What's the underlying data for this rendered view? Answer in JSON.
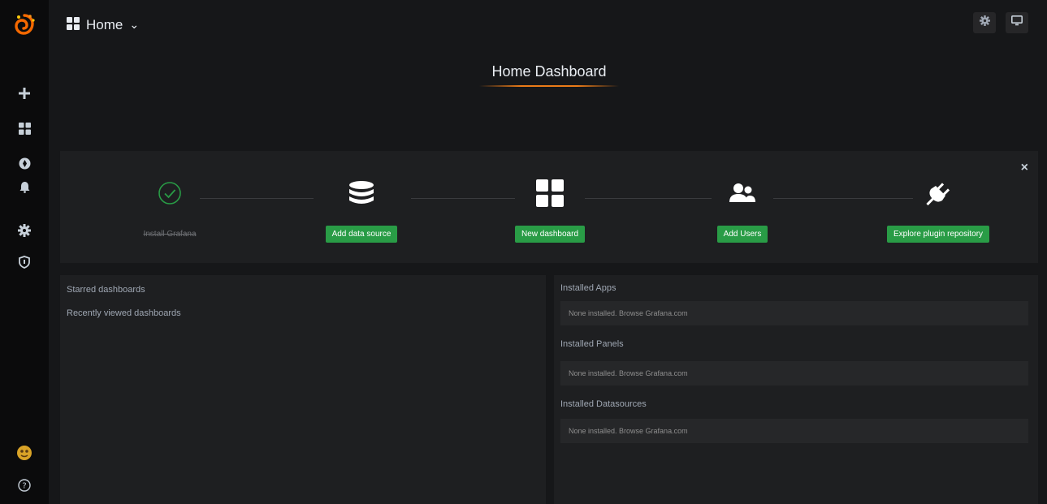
{
  "app": {
    "brand_color": "#eb7b18",
    "accent_color": "#299c46"
  },
  "sidebar": {
    "logo_icon": "grafana-logo-icon",
    "items": [
      {
        "name": "create",
        "icon": "plus-icon"
      },
      {
        "name": "dashboards",
        "icon": "grid-icon"
      },
      {
        "name": "explore",
        "icon": "compass-icon"
      },
      {
        "name": "alerting",
        "icon": "bell-icon"
      },
      {
        "name": "configuration",
        "icon": "gear-icon"
      },
      {
        "name": "server-admin",
        "icon": "shield-icon"
      }
    ],
    "bottom": [
      {
        "name": "profile",
        "icon": "avatar-icon"
      },
      {
        "name": "help",
        "icon": "help-icon"
      }
    ]
  },
  "header": {
    "dashboard_menu_label": "Home",
    "caret": "⌄",
    "buttons": [
      {
        "name": "settings",
        "icon": "gear-icon"
      },
      {
        "name": "cycle-view-mode",
        "icon": "monitor-icon"
      }
    ]
  },
  "dashboard": {
    "title": "Home Dashboard"
  },
  "getting_started": {
    "close_icon": "close-icon",
    "close_label": "×",
    "steps": [
      {
        "label": "Install Grafana",
        "done": true,
        "icon": "check-circle-icon"
      },
      {
        "label": "Add data source",
        "done": false,
        "icon": "database-icon"
      },
      {
        "label": "New dashboard",
        "done": false,
        "icon": "grid-icon"
      },
      {
        "label": "Add Users",
        "done": false,
        "icon": "users-icon"
      },
      {
        "label": "Explore plugin repository",
        "done": false,
        "icon": "plug-icon"
      }
    ]
  },
  "left_panel": {
    "starred": "Starred dashboards",
    "recent": "Recently viewed dashboards"
  },
  "right_panel": {
    "apps": {
      "title": "Installed Apps",
      "text": "None installed. Browse Grafana.com"
    },
    "panels": {
      "title": "Installed Panels",
      "text": "None installed. Browse Grafana.com"
    },
    "datasources": {
      "title": "Installed Datasources",
      "text": "None installed. Browse Grafana.com"
    }
  }
}
